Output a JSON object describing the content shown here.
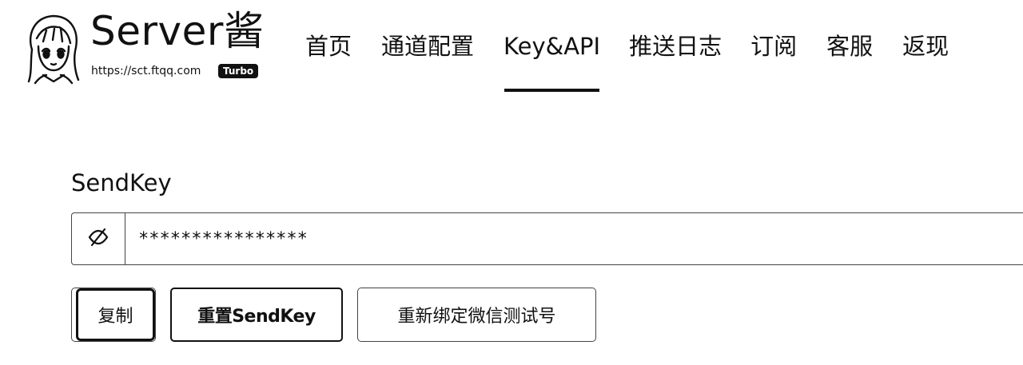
{
  "header": {
    "site_title": "Server酱",
    "site_url": "https://sct.ftqq.com",
    "badge": "Turbo",
    "avatar_icon": "anime-girl-avatar"
  },
  "nav": {
    "items": [
      {
        "label": "首页",
        "active": false
      },
      {
        "label": "通道配置",
        "active": false
      },
      {
        "label": "Key&API",
        "active": true
      },
      {
        "label": "推送日志",
        "active": false
      },
      {
        "label": "订阅",
        "active": false
      },
      {
        "label": "客服",
        "active": false
      },
      {
        "label": "返现",
        "active": false
      }
    ]
  },
  "sendkey": {
    "label": "SendKey",
    "value": "****************",
    "toggle_icon": "eye-slash-icon"
  },
  "actions": {
    "copy_label": "复制",
    "reset_label": "重置SendKey",
    "rebind_label": "重新绑定微信测试号"
  },
  "colors": {
    "text": "#111111",
    "border": "#444444",
    "background": "#ffffff"
  }
}
